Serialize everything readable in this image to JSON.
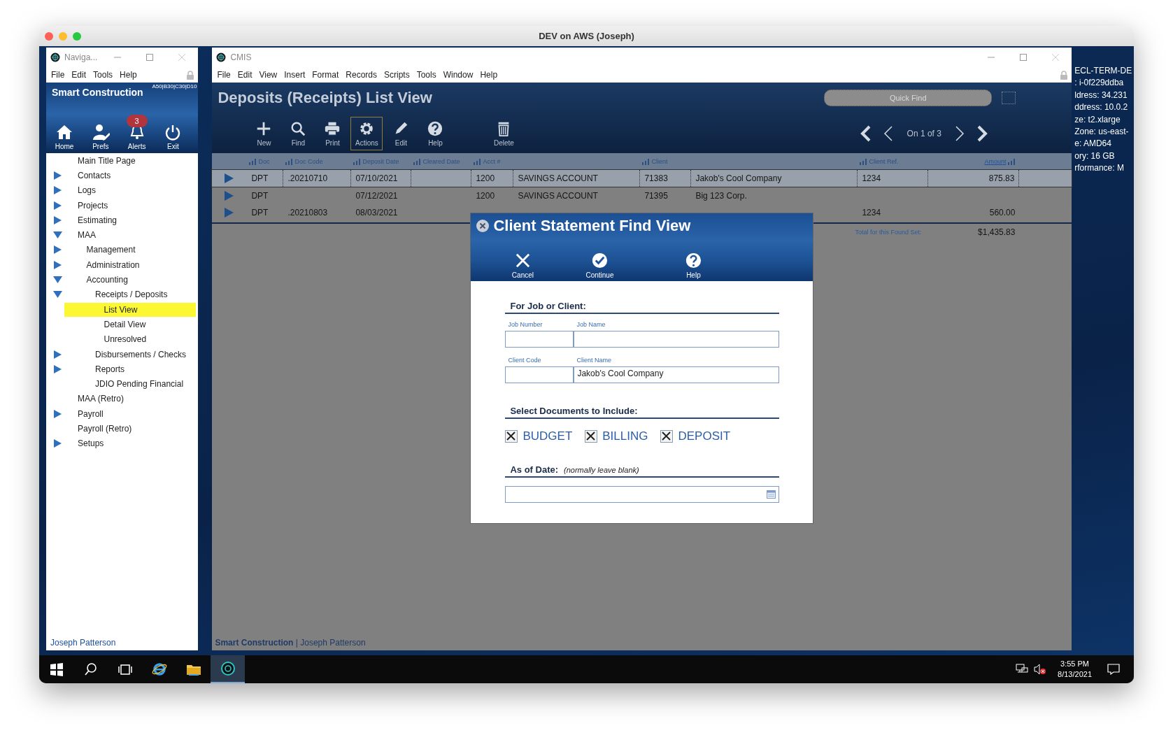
{
  "host_window": {
    "title": "DEV on AWS (Joseph)"
  },
  "navigator": {
    "title": "Naviga...",
    "menu": [
      "File",
      "Edit",
      "Tools",
      "Help"
    ],
    "app_name": "Smart Construction",
    "code": "A50|B30|C30|D10",
    "buttons": [
      {
        "kind": "home",
        "label": "Home"
      },
      {
        "kind": "prefs",
        "label": "Prefs"
      },
      {
        "kind": "alerts",
        "label": "Alerts",
        "badge": "3"
      },
      {
        "kind": "exit",
        "label": "Exit"
      }
    ],
    "tree": [
      {
        "label": "Main Title Page",
        "selected": false
      },
      {
        "label": "Contacts",
        "expanded": false,
        "selected": false
      },
      {
        "label": "Logs",
        "expanded": false,
        "selected": false
      },
      {
        "label": "Projects",
        "expanded": false,
        "selected": false
      },
      {
        "label": "Estimating",
        "expanded": false,
        "selected": false
      },
      {
        "label": "MAA",
        "expanded": true,
        "selected": false,
        "children": [
          {
            "label": "Management",
            "expanded": false,
            "selected": false
          },
          {
            "label": "Administration",
            "expanded": false,
            "selected": false
          },
          {
            "label": "Accounting",
            "expanded": true,
            "selected": false,
            "children": [
              {
                "label": "Receipts / Deposits",
                "expanded": true,
                "selected": false,
                "children": [
                  {
                    "label": "List View",
                    "selected": true
                  },
                  {
                    "label": "Detail View",
                    "selected": false
                  },
                  {
                    "label": "Unresolved",
                    "selected": false
                  }
                ]
              },
              {
                "label": "Disbursements / Checks",
                "expanded": false,
                "selected": false
              },
              {
                "label": "Reports",
                "expanded": false,
                "selected": false
              },
              {
                "label": "JDIO Pending Financial",
                "selected": false
              }
            ]
          }
        ]
      },
      {
        "label": "MAA (Retro)",
        "selected": false
      },
      {
        "label": "Payroll",
        "expanded": false,
        "selected": false
      },
      {
        "label": "Payroll (Retro)",
        "selected": false
      },
      {
        "label": "Setups",
        "expanded": false,
        "selected": false
      }
    ],
    "footer": "Joseph Patterson"
  },
  "cmis": {
    "title": "CMIS",
    "menu": [
      "File",
      "Edit",
      "View",
      "Insert",
      "Format",
      "Records",
      "Scripts",
      "Tools",
      "Window",
      "Help"
    ],
    "heading": "Deposits (Receipts) List View",
    "toolbar": [
      {
        "kind": "new",
        "label": "New",
        "selected": false
      },
      {
        "kind": "find",
        "label": "Find",
        "selected": false
      },
      {
        "kind": "print",
        "label": "Print",
        "selected": false
      },
      {
        "kind": "actions",
        "label": "Actions",
        "selected": true
      },
      {
        "kind": "edit",
        "label": "Edit",
        "selected": false
      },
      {
        "kind": "help",
        "label": "Help",
        "selected": false
      },
      {
        "kind": "delete",
        "label": "Delete",
        "selected": false
      }
    ],
    "quick_find": {
      "placeholder": "Quick Find"
    },
    "pager": "On 1 of 3",
    "table": {
      "columns": [
        {
          "label": "Doc"
        },
        {
          "label": "Doc Code"
        },
        {
          "label": "Deposit Date"
        },
        {
          "label": "Cleared Date"
        },
        {
          "label": "Acct #"
        },
        {
          "label": "Client"
        },
        {
          "label": "Client Ref."
        },
        {
          "label": "Amount"
        }
      ],
      "rows": [
        {
          "selected": true,
          "doc": "DPT",
          "doc_code": ".20210710",
          "deposit_date": "07/10/2021",
          "acct": "1200",
          "acct_name": "SAVINGS ACCOUNT",
          "client": "71383",
          "client_name": "Jakob's Cool Company",
          "client_ref": "1234",
          "amount": "875.83"
        },
        {
          "selected": false,
          "doc": "DPT",
          "deposit_date": "07/12/2021",
          "acct": "1200",
          "acct_name": "SAVINGS ACCOUNT",
          "client": "71395",
          "client_name": "Big 123 Corp."
        },
        {
          "selected": false,
          "doc": "DPT",
          "doc_code": ".20210803",
          "deposit_date": "08/03/2021",
          "client_ref": "1234",
          "amount": "560.00"
        }
      ],
      "total_label": "Total for this Found Set:",
      "total": "$1,435.83"
    },
    "status_bar": "**Smart Construction** | Joseph Patterson"
  },
  "dialog": {
    "title": "Client Statement Find View",
    "toolbar": [
      {
        "kind": "cancel",
        "label": "Cancel"
      },
      {
        "kind": "continue",
        "label": "Continue"
      },
      {
        "kind": "help",
        "label": "Help"
      }
    ],
    "job_section": "For Job or Client:",
    "fields": [
      {
        "label": "Job Number"
      },
      {
        "label": "Job Name"
      },
      {
        "label": "Client Code"
      },
      {
        "label": "Client Name",
        "value": "Jakob's Cool Company"
      }
    ],
    "documents_section": "Select Documents to Include:",
    "documents": [
      {
        "label": "BUDGET",
        "checked": true
      },
      {
        "label": "BILLING",
        "checked": true
      },
      {
        "label": "DEPOSIT",
        "checked": true
      }
    ],
    "date_section": {
      "label": "As of Date:",
      "hint": "(normally leave blank)"
    }
  },
  "desktop_info": [
    "ECL-TERM-DE",
    ": i-0f229ddba",
    "ldress: 34.231",
    "ddress: 10.0.2",
    "ze: t2.xlarge",
    "Zone: us-east-",
    "e: AMD64",
    "ory: 16 GB",
    "rformance: M"
  ],
  "taskbar": {
    "apps": [
      {
        "kind": "start",
        "selected": false
      },
      {
        "kind": "search",
        "selected": false
      },
      {
        "kind": "task_view",
        "selected": false
      },
      {
        "kind": "browser",
        "selected": false
      },
      {
        "kind": "files",
        "selected": false
      },
      {
        "kind": "cmis",
        "selected": true
      }
    ],
    "time": "3:55 PM",
    "date": "8/13/2021"
  }
}
